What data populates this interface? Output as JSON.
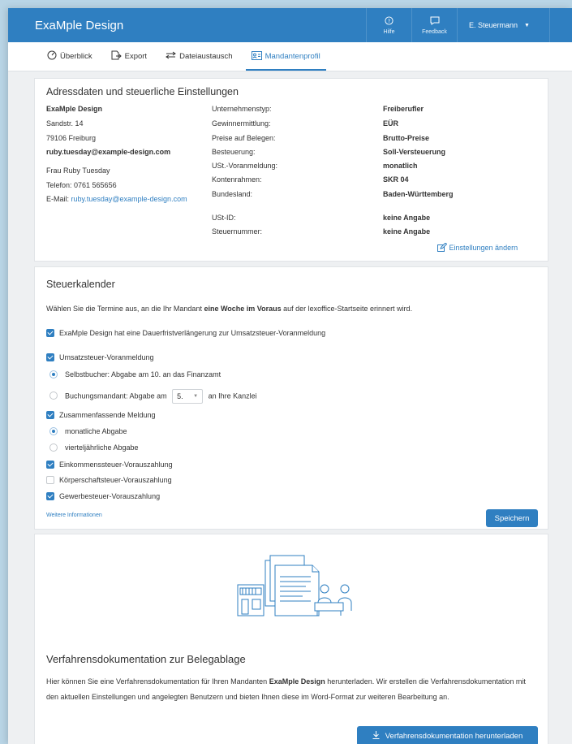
{
  "app": {
    "title": "ExaMple Design"
  },
  "topbar": {
    "help_label": "Hilfe",
    "feedback_label": "Feedback",
    "user_name": "E. Steuermann"
  },
  "tabs": [
    {
      "label": "Überblick",
      "icon": "gauge-icon"
    },
    {
      "label": "Export",
      "icon": "export-icon"
    },
    {
      "label": "Dateiaustausch",
      "icon": "swap-arrows-icon"
    },
    {
      "label": "Mandantenprofil",
      "icon": "profile-card-icon",
      "active": true
    }
  ],
  "address": {
    "heading": "Adressdaten und steuerliche Einstellungen",
    "company": "ExaMple Design",
    "street": "Sandstr. 14",
    "city": "79106 Freiburg",
    "email_primary": "ruby.tuesday@example-design.com",
    "contact_name": "Frau Ruby Tuesday",
    "phone": "Telefon:  0761 565656",
    "email_label": "E-Mail:",
    "email": "ruby.tuesday@example-design.com",
    "settings": [
      {
        "label": "Unternehmenstyp:",
        "value": "Freiberufler"
      },
      {
        "label": "Gewinnermittlung:",
        "value": "EÜR"
      },
      {
        "label": "Preise auf Belegen:",
        "value": "Brutto-Preise"
      },
      {
        "label": "Besteuerung:",
        "value": "Soll-Versteuerung"
      },
      {
        "label": "USt.-Voranmeldung:",
        "value": "monatlich"
      },
      {
        "label": "Kontenrahmen:",
        "value": "SKR 04"
      },
      {
        "label": "Bundesland:",
        "value": "Baden-Württemberg"
      },
      {
        "label": "USt-ID:",
        "value": "keine Angabe"
      },
      {
        "label": "Steuernummer:",
        "value": "keine Angabe"
      }
    ],
    "edit_link": "Einstellungen ändern"
  },
  "calendar": {
    "heading": "Steuerkalender",
    "intro_pre": "Wählen Sie die Termine aus, an die Ihr Mandant ",
    "intro_bold": "eine Woche im Voraus",
    "intro_post": " auf der lexoffice-Startseite erinnert wird.",
    "extension": "ExaMple Design hat eine Dauerfristverlängerung zur Umsatzsteuer-Voranmeldung",
    "ust": "Umsatzsteuer-Voranmeldung",
    "ust_opt1": "Selbstbucher: Abgabe am 10. an das Finanzamt",
    "ust_opt2_pre": "Buchungsmandant: Abgabe am",
    "ust_opt2_day": "5.",
    "ust_opt2_post": "an Ihre Kanzlei",
    "zm": "Zusammenfassende Meldung",
    "zm_opt1": "monatliche Abgabe",
    "zm_opt2": "vierteljährliche Abgabe",
    "est": "Einkommenssteuer-Vorauszahlung",
    "kst": "Körperschaftsteuer-Vorauszahlung",
    "gst": "Gewerbesteuer-Vorauszahlung",
    "more_link": "Weitere Informationen",
    "save_label": "Speichern"
  },
  "procedure": {
    "heading": "Verfahrensdokumentation zur Belegablage",
    "text_pre": "Hier können Sie eine Verfahrensdokumentation für Ihren Mandanten ",
    "text_bold": "ExaMple Design",
    "text_post": " herunterladen. Wir erstellen die Verfahrensdokumentation mit den aktuellen Einstellungen und angelegten Benutzern und bieten Ihnen diese im Word-Format zur weiteren Bearbeitung an.",
    "download_label": "Verfahrensdokumentation herunterladen"
  },
  "colors": {
    "accent": "#2f7fc1",
    "background": "#eef0f2"
  }
}
